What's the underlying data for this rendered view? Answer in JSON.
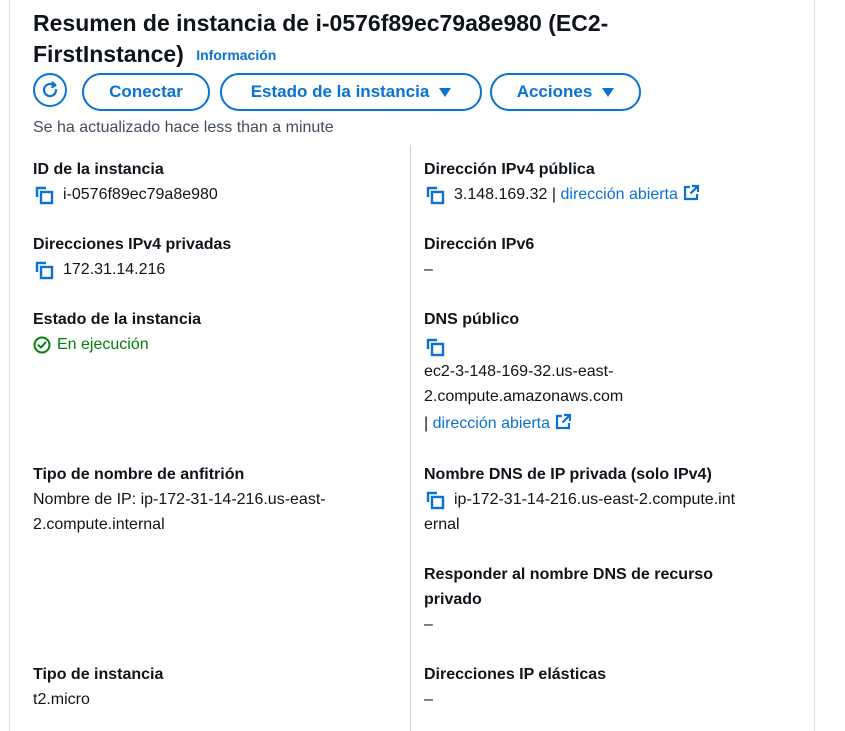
{
  "header": {
    "title": "Resumen de instancia de i-0576f89ec79a8e980 (EC2-FirstInstance)",
    "info_link": "Información"
  },
  "toolbar": {
    "refresh_icon": "refresh-icon",
    "connect_label": "Conectar",
    "state_label": "Estado de la instancia",
    "actions_label": "Acciones"
  },
  "updated_text": "Se ha actualizado hace less than a minute",
  "left": {
    "instance_id": {
      "label": "ID de la instancia",
      "value": "i-0576f89ec79a8e980"
    },
    "private_ipv4": {
      "label": "Direcciones IPv4 privadas",
      "value": "172.31.14.216"
    },
    "instance_state": {
      "label": "Estado de la instancia",
      "value": "En ejecución"
    },
    "hostname_type": {
      "label": "Tipo de nombre de anfitrión",
      "value_line1": "Nombre de IP: ip-172-31-14-216.us-east-",
      "value_line2": "2.compute.internal"
    },
    "instance_type": {
      "label": "Tipo de instancia",
      "value": "t2.micro"
    }
  },
  "right": {
    "public_ipv4": {
      "label": "Dirección IPv4 pública",
      "value": "3.148.169.32",
      "sep": "|",
      "link": "dirección abierta"
    },
    "ipv6": {
      "label": "Dirección IPv6",
      "value": "–"
    },
    "public_dns": {
      "label": "DNS público",
      "value_line1": "ec2-3-148-169-32.us-east-",
      "value_line2": "2.compute.amazonaws.com",
      "sep": "|",
      "link": "dirección abierta"
    },
    "private_dns": {
      "label": "Nombre DNS de IP privada (solo IPv4)",
      "value_line1": "ip-172-31-14-216.us-east-2.compute.int",
      "value_line2": "ernal"
    },
    "resource_dns": {
      "label_line1": "Responder al nombre DNS de recurso",
      "label_line2": "privado",
      "value": "–"
    },
    "elastic_ip": {
      "label": "Direcciones IP elásticas",
      "value": "–"
    }
  }
}
